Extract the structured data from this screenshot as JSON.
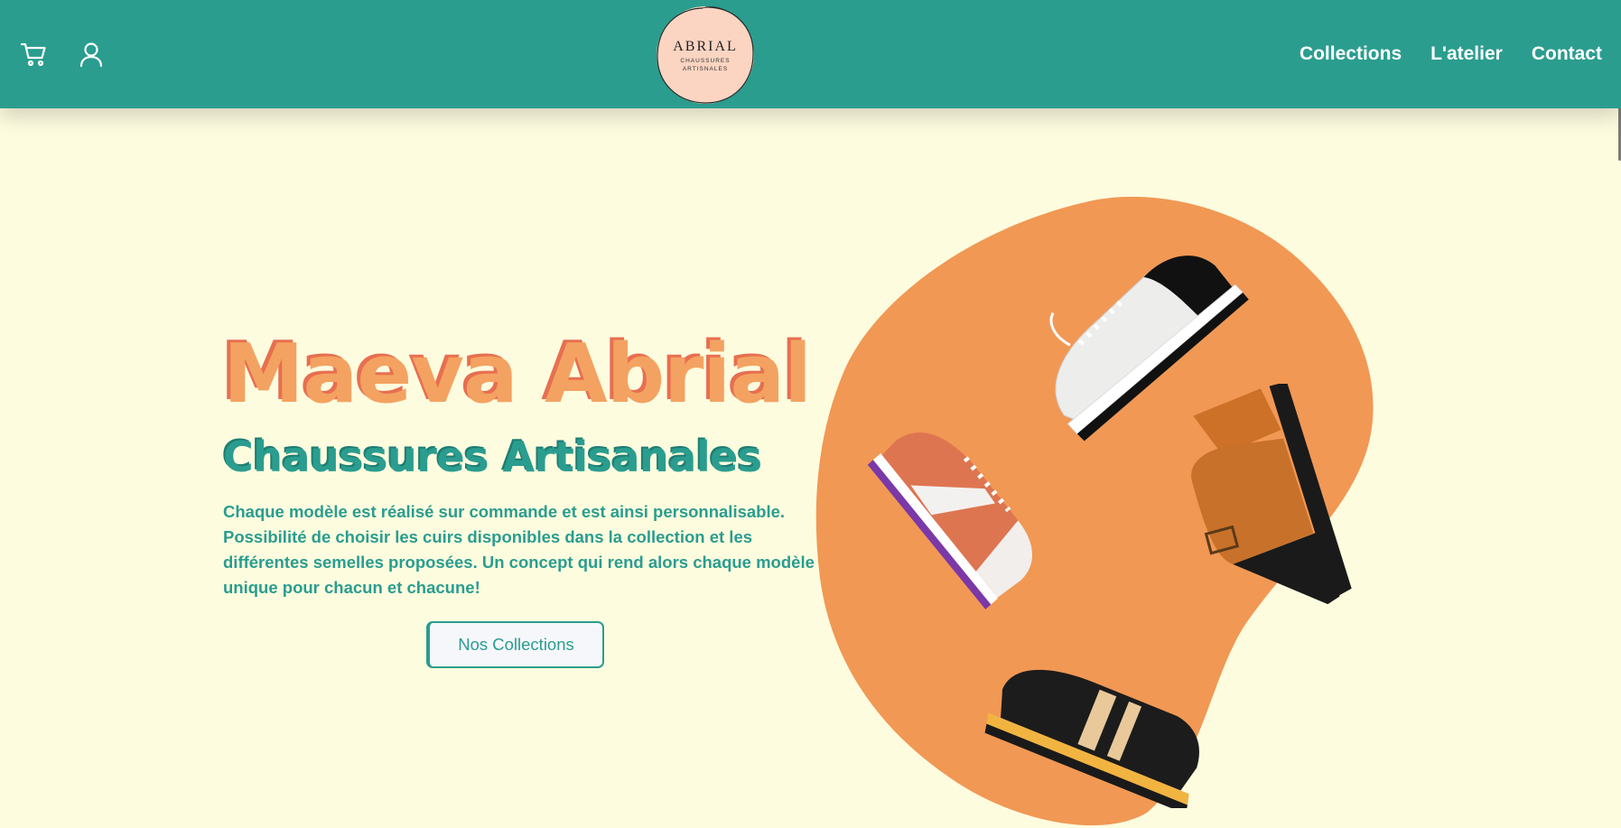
{
  "header": {
    "icons": {
      "cart": "cart-icon",
      "account": "user-icon"
    },
    "logo": {
      "name": "ABRIAL",
      "line1": "CHAUSSURES",
      "line2": "ARTISNALES"
    },
    "nav": [
      "Collections",
      "L'atelier",
      "Contact"
    ]
  },
  "hero": {
    "title": "Maeva Abrial",
    "subtitle": "Chaussures Artisanales",
    "description": "Chaque modèle est réalisé sur commande et est ainsi personnalisable. Possibilité de choisir les cuirs disponibles dans la collection et les différentes semelles proposées. Un concept qui rend alors chaque modèle unique pour chacun et chacune!",
    "cta": "Nos Collections"
  },
  "colors": {
    "brand_teal": "#2a9d8f",
    "accent_orange": "#f4a261",
    "accent_coral": "#e76f51",
    "background": "#fefcdf",
    "logo_pink": "#fcd5c2"
  }
}
